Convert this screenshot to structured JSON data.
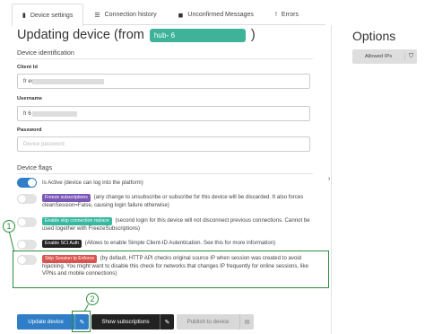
{
  "tabs": [
    {
      "label": "Device settings",
      "icon": "sliders-icon",
      "glyph": "▮"
    },
    {
      "label": "Connection history",
      "icon": "list-icon",
      "glyph": "☰"
    },
    {
      "label": "Unconfirmed Messages",
      "icon": "chat-icon",
      "glyph": "◼"
    },
    {
      "label": "Errors",
      "icon": "exclamation-icon",
      "glyph": "!"
    }
  ],
  "title": {
    "prefix": "Updating device (from",
    "hub_badge": "hub-                       6",
    "suffix": ")"
  },
  "identification": {
    "section": "Device identification",
    "client_id_label": "Client Id",
    "client_id_value": "fr                                es",
    "username_label": "Username",
    "username_value": "fr                                6",
    "password_label": "Password",
    "password_placeholder": "Device password"
  },
  "flags": {
    "section": "Device flags",
    "is_active": {
      "text": "Is Active (device can log into the platform)",
      "on": true
    },
    "freeze": {
      "chip": "Freeze subscriptions",
      "text": "(any change to unsubscribe or subscribe for this device will be discarded. It also forces cleanSession=False, causing login failure otherwise)",
      "on": false
    },
    "skip_conn": {
      "chip": "Enable skip connection replace",
      "text": "(second login for this device will not disconnect previous connections. Cannot be used together with FreezeSubscriptions)",
      "on": false
    },
    "sci_auth": {
      "chip": "Enable SCI Auth",
      "text": "(Allows to enable Simple Client-ID Autentication. See this for more information)",
      "on": false
    },
    "skip_ip": {
      "chip": "Skip Session Ip Enforce",
      "text": "(by default, HTTP API checks original source IP when session was created to avoid hijacking. You might want to disable this check for networks that changes IP frequently for online sessions, like VPNs and mobile connections)",
      "on": false
    }
  },
  "callouts": {
    "one": "1",
    "two": "2"
  },
  "buttons": {
    "update": "Update device",
    "show_subs": "Show subscriptions",
    "publish": "Publish to device"
  },
  "options": {
    "title": "Options",
    "allowed_ips": "Allowed IPs"
  },
  "colors": {
    "primary": "#2f7ec7",
    "hub_badge": "#3fb39a",
    "annotation": "#2e8b3e",
    "freeze_chip": "#7b58b8",
    "skip_chip": "#37b8a0",
    "sci_chip": "#222222",
    "skip_ip_chip": "#d9534f"
  }
}
